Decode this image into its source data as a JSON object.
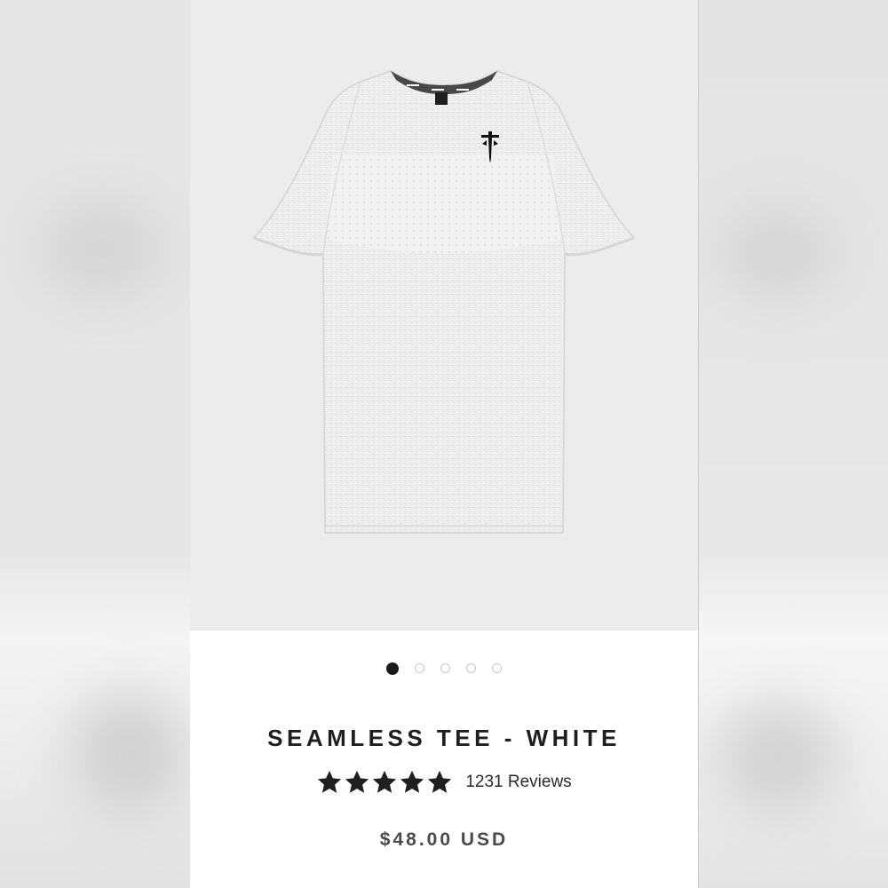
{
  "product": {
    "title": "SEAMLESS TEE - WHITE",
    "price": "$48.00 USD",
    "rating": {
      "stars_filled": 5,
      "stars_total": 5,
      "reviews_label": "1231 Reviews"
    }
  },
  "gallery": {
    "slide_count": 5,
    "active_index": 0,
    "image_alt": "white seamless tee"
  },
  "colors": {
    "star": "#1f1f1f",
    "title": "#1f1f1f",
    "price": "#4a4a4a",
    "active_dot": "#1a1a1a"
  },
  "icons": [
    "star-icon",
    "nail-logo-icon"
  ]
}
